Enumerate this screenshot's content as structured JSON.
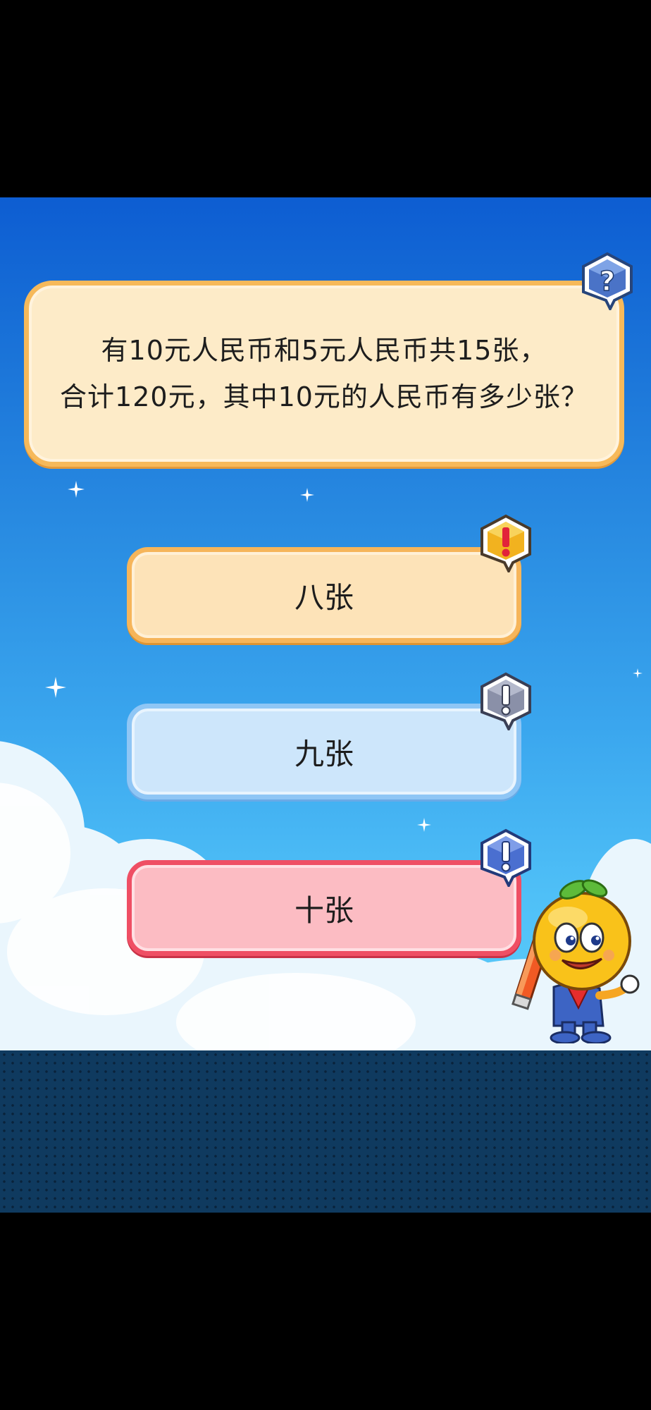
{
  "question": {
    "text": "有10元人民币和5元人民币共15张，\n合计120元，其中10元的人民币有多少张？",
    "badge_icon": "question-mark-icon"
  },
  "answers": [
    {
      "label": "八张",
      "state": "default",
      "badge_icon": "exclamation-icon"
    },
    {
      "label": "九张",
      "state": "option",
      "badge_icon": "exclamation-icon"
    },
    {
      "label": "十张",
      "state": "selected-wrong",
      "badge_icon": "exclamation-icon"
    }
  ],
  "colors": {
    "question_fill": "#fdebc8",
    "question_border": "#f6b95a",
    "answer1_border": "#f6b55a",
    "answer2_border": "#8fc6f5",
    "answer3_border": "#ef4f64",
    "sky_top": "#0d5dd2",
    "sky_bottom": "#5fcffb",
    "ground": "#0f3a5f"
  },
  "mascot": {
    "icon": "orange-mascot-with-pencil-icon"
  }
}
